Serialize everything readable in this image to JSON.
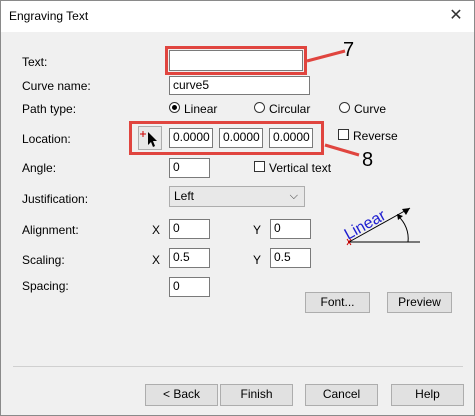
{
  "window": {
    "title": "Engraving Text",
    "close_glyph": "✕"
  },
  "form": {
    "text": {
      "label": "Text:",
      "value": ""
    },
    "curve_name": {
      "label": "Curve name:",
      "value": "curve5"
    },
    "path_type": {
      "label": "Path type:",
      "options": [
        "Linear",
        "Circular",
        "Curve"
      ],
      "selected": "Linear"
    },
    "location": {
      "label": "Location:",
      "x": "0.0000",
      "y": "0.0000",
      "z": "0.0000",
      "reverse_label": "Reverse",
      "reverse_checked": false
    },
    "angle": {
      "label": "Angle:",
      "value": "0",
      "vertical_label": "Vertical text",
      "vertical_checked": false
    },
    "justification": {
      "label": "Justification:",
      "value": "Left"
    },
    "alignment": {
      "label": "Alignment:",
      "x_label": "X",
      "x": "0",
      "y_label": "Y",
      "y": "0"
    },
    "scaling": {
      "label": "Scaling:",
      "x_label": "X",
      "x": "0.5",
      "y_label": "Y",
      "y": "0.5"
    },
    "spacing": {
      "label": "Spacing:",
      "value": "0"
    }
  },
  "preview_graphic": {
    "text": "Linear"
  },
  "buttons": {
    "font": "Font...",
    "preview": "Preview",
    "back": "< Back",
    "finish": "Finish",
    "cancel": "Cancel",
    "help": "Help"
  },
  "callouts": {
    "c7": "7",
    "c8": "8"
  },
  "colors": {
    "annotation_red": "#e0453f",
    "preview_blue": "#1f1fd0",
    "pick_red": "#d00000"
  }
}
